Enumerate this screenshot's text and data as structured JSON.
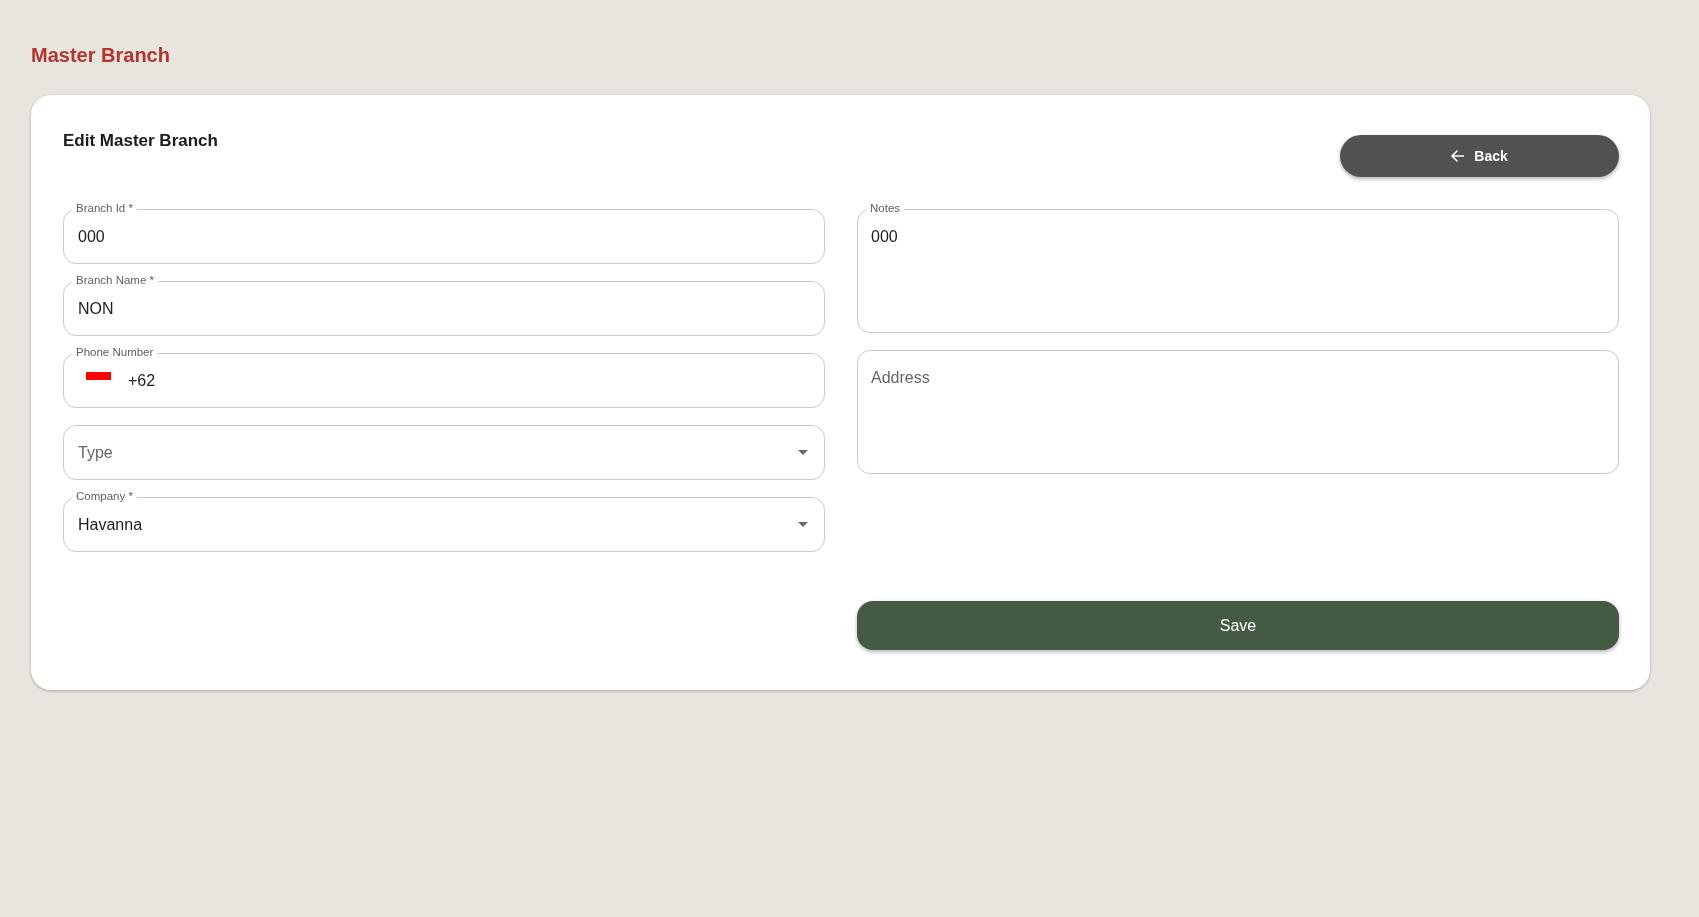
{
  "page_title": "Master Branch",
  "form": {
    "title": "Edit Master Branch",
    "back_button": {
      "label": "Back"
    },
    "left_fields": [
      {
        "kind": "text",
        "label": "Branch Id *",
        "value": "000"
      },
      {
        "kind": "text",
        "label": "Branch Name *",
        "value": "NON"
      },
      {
        "kind": "phone",
        "label": "Phone Number",
        "value": "+62"
      },
      {
        "kind": "select",
        "placeholder": "Type"
      },
      {
        "kind": "select",
        "label": "Company *",
        "value": "Havanna"
      }
    ],
    "right_fields": [
      {
        "kind": "textarea",
        "label": "Notes",
        "value": "000"
      },
      {
        "kind": "textarea",
        "placeholder": "Address"
      }
    ],
    "save_button": {
      "label": "Save"
    }
  }
}
